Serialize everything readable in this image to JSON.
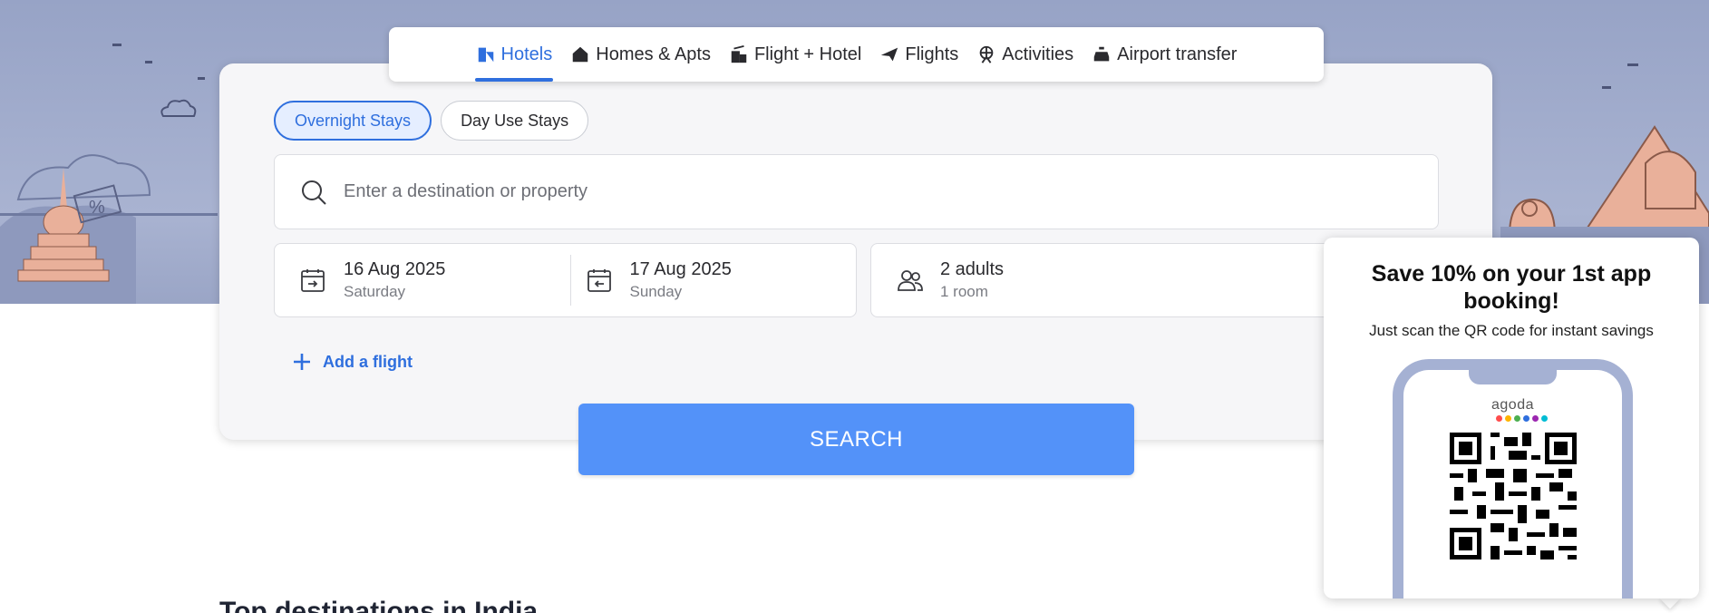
{
  "tabs": [
    {
      "label": "Hotels",
      "icon": "hotel-icon",
      "active": true
    },
    {
      "label": "Homes & Apts",
      "icon": "home-icon",
      "active": false
    },
    {
      "label": "Flight + Hotel",
      "icon": "flight-hotel-icon",
      "active": false
    },
    {
      "label": "Flights",
      "icon": "plane-icon",
      "active": false
    },
    {
      "label": "Activities",
      "icon": "ferris-wheel-icon",
      "active": false
    },
    {
      "label": "Airport transfer",
      "icon": "car-icon",
      "active": false
    }
  ],
  "stay_type": {
    "overnight": "Overnight Stays",
    "day_use": "Day Use Stays",
    "selected": "Overnight Stays"
  },
  "search": {
    "placeholder": "Enter a destination or property",
    "button": "SEARCH"
  },
  "dates": {
    "check_in": {
      "date": "16 Aug 2025",
      "day": "Saturday"
    },
    "check_out": {
      "date": "17 Aug 2025",
      "day": "Sunday"
    }
  },
  "occupancy": {
    "guests": "2 adults",
    "rooms": "1 room"
  },
  "add_flight": "Add a flight",
  "section": {
    "title": "Top destinations in India"
  },
  "promo": {
    "title": "Save 10% on your 1st app booking!",
    "subtitle": "Just scan the QR code for instant savings",
    "brand": "agoda",
    "brand_dot_colors": [
      "#ff4d4d",
      "#ffb400",
      "#4caf50",
      "#2f6fde",
      "#9c27b0",
      "#00bcd4"
    ]
  },
  "colors": {
    "accent": "#2f6fde",
    "search_button": "#5392f9",
    "hero": "#97a3c6"
  }
}
